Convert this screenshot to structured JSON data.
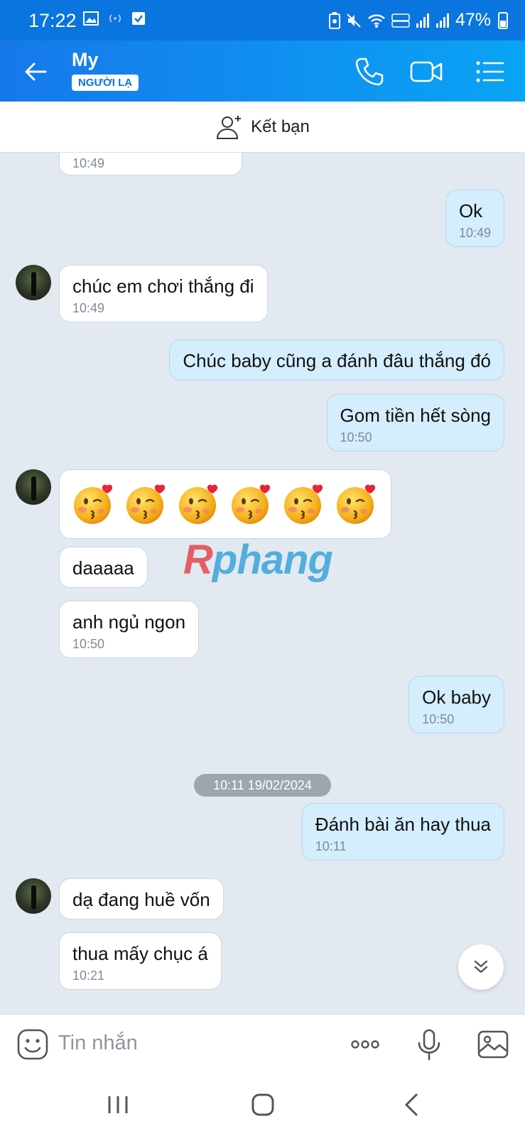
{
  "status_bar": {
    "time": "17:22",
    "battery": "47%"
  },
  "header": {
    "contact_name": "My",
    "badge": "NGƯỜI LẠ"
  },
  "add_friend": {
    "label": "Kết bạn"
  },
  "messages": [
    {
      "time": "10:49"
    },
    {
      "text": "Ok",
      "time": "10:49"
    },
    {
      "text": "chúc em chơi thắng đi",
      "time": "10:49"
    },
    {
      "text": "Chúc baby cũng a đánh đâu thắng đó"
    },
    {
      "text": "Gom tiền hết sòng",
      "time": "10:50"
    },
    {
      "text": "daaaaa"
    },
    {
      "text": "anh ngủ ngon",
      "time": "10:50"
    },
    {
      "text": "Ok baby",
      "time": "10:50"
    },
    {
      "text": "Đánh bài ăn hay thua",
      "time": "10:11"
    },
    {
      "text": "dạ đang huề vốn"
    },
    {
      "text": "thua mấy chục á",
      "time": "10:21"
    }
  ],
  "date_separator": "10:11 19/02/2024",
  "watermark": {
    "part1": "R",
    "part2": "phang"
  },
  "composer": {
    "placeholder": "Tin nhắn"
  },
  "colors": {
    "header_start": "#1678ea",
    "header_end": "#0aa4f5",
    "outgoing_bubble": "#d4eefd",
    "chat_background": "#e2e9f1"
  }
}
